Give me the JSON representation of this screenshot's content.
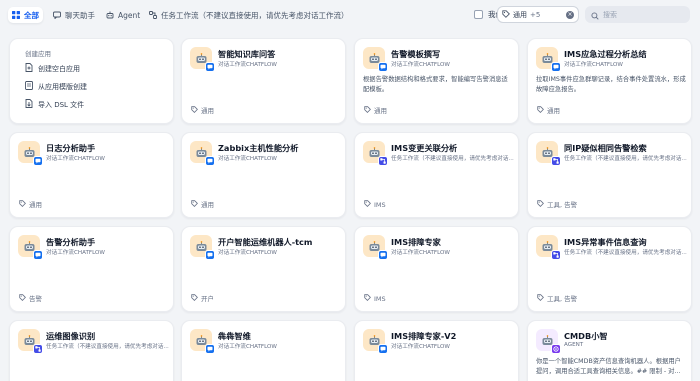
{
  "tabs": [
    {
      "label": "全部",
      "icon": "grid-icon",
      "active": true
    },
    {
      "label": "聊天助手",
      "icon": "chat-icon",
      "active": false
    },
    {
      "label": "Agent",
      "icon": "agent-icon",
      "active": false
    },
    {
      "label": "任务工作流（不建议直接使用，请优先考虑对话工作流）",
      "icon": "workflow-icon",
      "active": false
    }
  ],
  "filters": {
    "mine_label": "我创建的",
    "tag_label": "通用",
    "tag_more": "+5",
    "search_placeholder": "搜索"
  },
  "create": {
    "title": "创建应用",
    "items": [
      {
        "label": "创建空白应用",
        "icon": "file-plus-icon"
      },
      {
        "label": "从应用模版创建",
        "icon": "template-icon"
      },
      {
        "label": "导入 DSL 文件",
        "icon": "import-icon"
      }
    ]
  },
  "apps": [
    {
      "name": "智能知识库问答",
      "type": "对话工作流CHATFLOW",
      "desc": "",
      "tag": "通用",
      "badge": "chat"
    },
    {
      "name": "告警模板撰写",
      "type": "对话工作流CHATFLOW",
      "desc": "根据告警数据结构和格式要求，智能编写告警消息适配模板。",
      "tag": "通用",
      "badge": "chat"
    },
    {
      "name": "IMS应急过程分析总结",
      "type": "对话工作流CHATFLOW",
      "desc": "拉取IMS事件应急群聊记录，结合事件处置流水，形成故障应急报告。",
      "tag": "通用",
      "badge": "chat"
    },
    {
      "name": "日志分析助手",
      "type": "对话工作流CHATFLOW",
      "desc": "",
      "tag": "通用",
      "badge": "chat"
    },
    {
      "name": "Zabbix主机性能分析",
      "type": "对话工作流CHATFLOW",
      "desc": "",
      "tag": "通用",
      "badge": "chat"
    },
    {
      "name": "IMS变更关联分析",
      "type": "任务工作流（不建议直接使用，请优先考虑对话...",
      "desc": "",
      "tag": "IMS",
      "badge": "wf"
    },
    {
      "name": "同IP疑似相同告警检索",
      "type": "任务工作流（不建议直接使用，请优先考虑对话...",
      "desc": "",
      "tag": "工具, 告警",
      "badge": "wf"
    },
    {
      "name": "告警分析助手",
      "type": "对话工作流CHATFLOW",
      "desc": "",
      "tag": "告警",
      "badge": "chat"
    },
    {
      "name": "开户智能运维机器人-tcm",
      "type": "对话工作流CHATFLOW",
      "desc": "",
      "tag": "开户",
      "badge": "chat"
    },
    {
      "name": "IMS排障专家",
      "type": "对话工作流CHATFLOW",
      "desc": "",
      "tag": "IMS",
      "badge": "chat"
    },
    {
      "name": "IMS异常事件信息查询",
      "type": "任务工作流（不建议直接使用，请优先考虑对话...",
      "desc": "",
      "tag": "工具, 告警",
      "badge": "wf"
    },
    {
      "name": "运维图像识别",
      "type": "任务工作流（不建议直接使用，请优先考虑对话...",
      "desc": "",
      "tag": "",
      "badge": "wf"
    },
    {
      "name": "犇犇智维",
      "type": "对话工作流CHATFLOW",
      "desc": "",
      "tag": "",
      "badge": "chat"
    },
    {
      "name": "IMS排障专家-V2",
      "type": "对话工作流CHATFLOW",
      "desc": "",
      "tag": "",
      "badge": "chat"
    },
    {
      "name": "CMDB小智",
      "type": "AGENT",
      "desc": "你是一个智能CMDB资产信息查询机器人。根据用户提问，调用合适工具查询相关信息。## 限制 - 对...",
      "tag": "",
      "badge": "agent"
    }
  ]
}
